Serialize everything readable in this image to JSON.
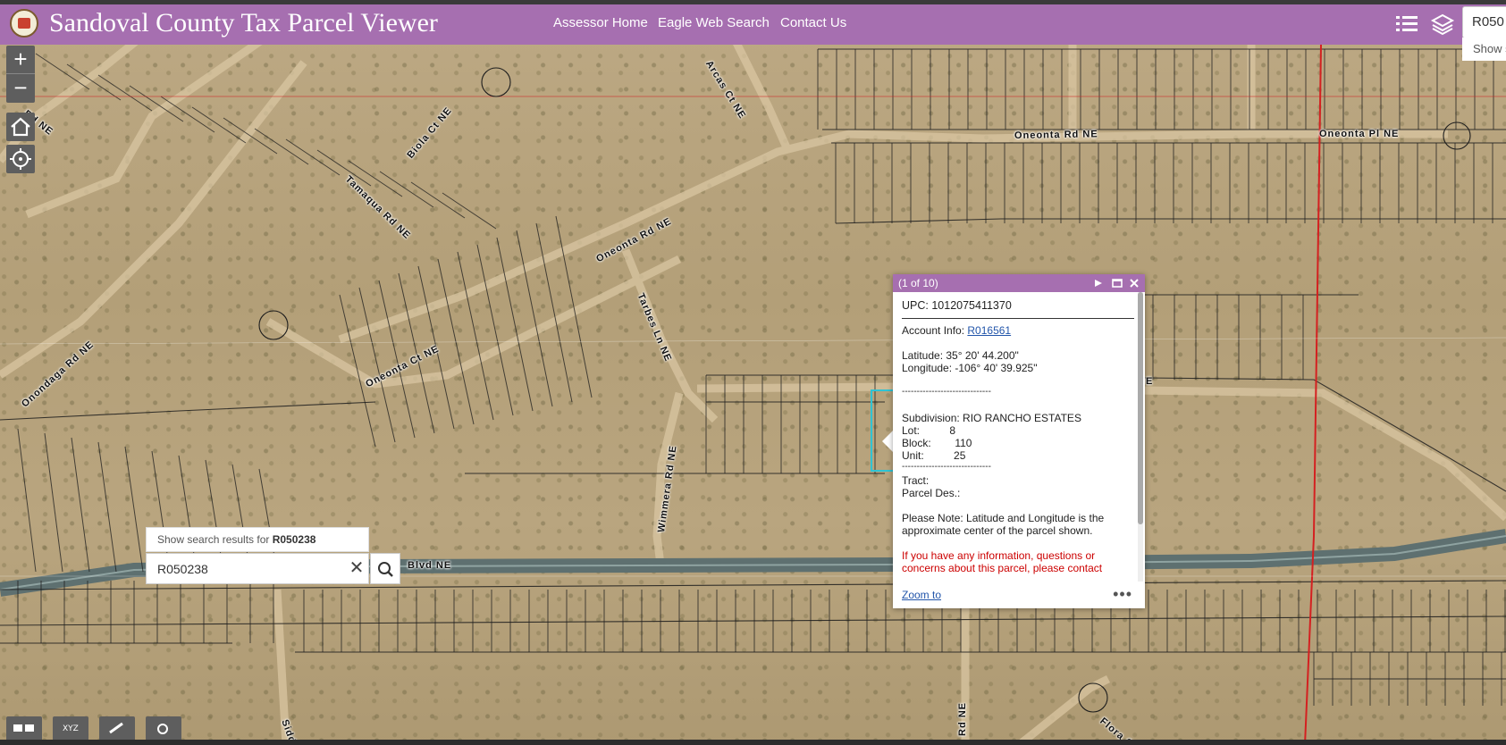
{
  "header": {
    "title": "Sandoval County Tax Parcel Viewer",
    "nav": [
      {
        "label": "Assessor Home"
      },
      {
        "label": "Eagle Web Search"
      },
      {
        "label": "Contact Us"
      }
    ],
    "search_value": "R050",
    "search_hint": "Show s"
  },
  "map": {
    "roads": [
      {
        "label": "Rd NE"
      },
      {
        "label": "Biola Ct NE"
      },
      {
        "label": "Arcas Ct NE"
      },
      {
        "label": "Tamaqua Rd NE"
      },
      {
        "label": "Oneonta Rd NE"
      },
      {
        "label": "Oneonta Pl NE"
      },
      {
        "label": "Oneonta Rd NE"
      },
      {
        "label": "Tarbes Ln NE"
      },
      {
        "label": "Onondaga Rd NE"
      },
      {
        "label": "Oneonta Ct NE"
      },
      {
        "label": "Wimmera Rd NE"
      },
      {
        "label": "Blvd NE"
      },
      {
        "label": "E"
      },
      {
        "label": "Sidd"
      },
      {
        "label": "Rd NE"
      },
      {
        "label": "Flora C"
      }
    ]
  },
  "search": {
    "hint_prefix": "Show search results for ",
    "hint_query": "R050238",
    "value": "R050238"
  },
  "popup": {
    "counter": "(1 of 10)",
    "upc": "UPC: 1012075411370",
    "account_label": "Account Info: ",
    "account_link": "R016561",
    "latitude": "Latitude: 35° 20' 44.200\"",
    "longitude": "Longitude: -106° 40' 39.925\"",
    "separator": "------------------------------",
    "subdivision": "Subdivision: RIO RANCHO ESTATES",
    "lot": "Lot:          8",
    "block": "Block:        110",
    "unit": "Unit:          25",
    "separator2": "------------------------------",
    "tract": "Tract:",
    "parcel_des": "Parcel Des.:",
    "note_1": "Please Note: Latitude and Longitude is the",
    "note_2": "approximate center of the parcel shown.",
    "warning_1": "If you have any information, questions or",
    "warning_2": "concerns about this parcel, please contact",
    "zoom_to": "Zoom to",
    "more": "•••"
  },
  "colors": {
    "brand": "#a66fb0",
    "selection": "#2ec4d4",
    "link": "#2255aa",
    "warning": "#cc0000"
  },
  "icons": [
    "list-icon",
    "layers-icon",
    "zoom-in-icon",
    "zoom-out-icon",
    "home-icon",
    "locate-icon",
    "play-icon",
    "maximize-icon",
    "close-icon",
    "clear-icon",
    "search-icon",
    "basemap-icon",
    "coordinates-icon",
    "measure-icon",
    "magnify-icon"
  ]
}
